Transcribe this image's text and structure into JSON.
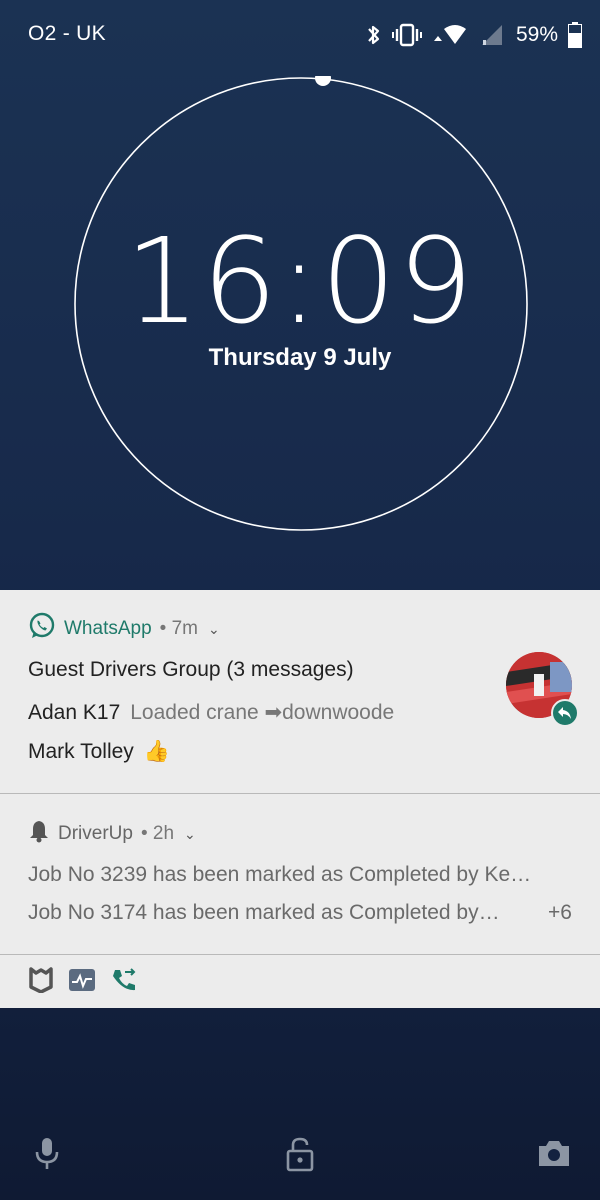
{
  "status_bar": {
    "carrier": "O2 - UK",
    "battery_percent": "59%",
    "battery_level": 0.59,
    "icons": [
      "bluetooth-icon",
      "vibrate-icon",
      "wifi-icon",
      "cell-signal-icon",
      "battery-icon"
    ]
  },
  "clock": {
    "time": "16:09",
    "date": "Thursday 9 July"
  },
  "notifications": {
    "whatsapp": {
      "app_name": "WhatsApp",
      "time": "7m",
      "title": "Guest Drivers Group (3 messages)",
      "messages": [
        {
          "sender": "Adan K17",
          "text": "Loaded crane ➡downwoode"
        },
        {
          "sender": "Mark Tolley",
          "text": "👍"
        }
      ],
      "accent_color": "#1f7a6a"
    },
    "driverup": {
      "app_name": "DriverUp",
      "time": "2h",
      "lines": [
        "Job No 3239 has been marked as Completed by Ke…",
        "Job No 3174 has been marked as Completed by…"
      ],
      "more_count": "+6"
    },
    "shelf_icons": [
      "shield-icon",
      "activity-icon",
      "call-forward-icon"
    ]
  },
  "bottom": {
    "icons": [
      "microphone-icon",
      "unlock-icon",
      "camera-icon"
    ]
  }
}
